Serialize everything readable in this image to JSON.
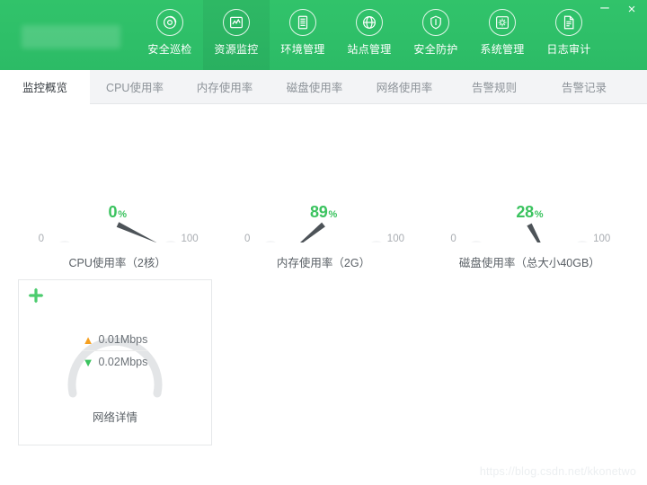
{
  "window": {
    "minimize_label": "–",
    "close_label": "×",
    "brand_redacted": true,
    "header_color": "#2fc069"
  },
  "nav": {
    "items": [
      {
        "label": "安全巡检",
        "icon": "radar-scan-icon",
        "active": false
      },
      {
        "label": "资源监控",
        "icon": "chart-monitor-icon",
        "active": true
      },
      {
        "label": "环境管理",
        "icon": "server-stack-icon",
        "active": false
      },
      {
        "label": "站点管理",
        "icon": "globe-icon",
        "active": false
      },
      {
        "label": "安全防护",
        "icon": "shield-icon",
        "active": false
      },
      {
        "label": "系统管理",
        "icon": "gear-box-icon",
        "active": false
      },
      {
        "label": "日志审计",
        "icon": "document-icon",
        "active": false
      }
    ]
  },
  "tabs": [
    {
      "label": "监控概览",
      "active": true
    },
    {
      "label": "CPU使用率",
      "active": false
    },
    {
      "label": "内存使用率",
      "active": false
    },
    {
      "label": "磁盘使用率",
      "active": false
    },
    {
      "label": "网络使用率",
      "active": false
    },
    {
      "label": "告警规则",
      "active": false
    },
    {
      "label": "告警记录",
      "active": false
    }
  ],
  "chart_data": [
    {
      "type": "gauge",
      "title": "CPU使用率（2核）",
      "value": 0,
      "value_text": "0",
      "unit": "%",
      "min": 0,
      "max": 100,
      "min_label": "0",
      "max_label": "100",
      "value_color": "#3bc35f",
      "bands": [
        {
          "from": 0,
          "to": 8,
          "color": "#2196f3"
        },
        {
          "from": 8,
          "to": 72,
          "color": "#62c133"
        },
        {
          "from": 72,
          "to": 86,
          "color": "#f59c1a"
        },
        {
          "from": 86,
          "to": 100,
          "color": "#e63c2f"
        }
      ]
    },
    {
      "type": "gauge",
      "title": "内存使用率（2G）",
      "value": 89,
      "value_text": "89",
      "unit": "%",
      "min": 0,
      "max": 100,
      "min_label": "0",
      "max_label": "100",
      "value_color": "#3bc35f",
      "bands": [
        {
          "from": 0,
          "to": 8,
          "color": "#2196f3"
        },
        {
          "from": 8,
          "to": 72,
          "color": "#62c133"
        },
        {
          "from": 72,
          "to": 86,
          "color": "#f59c1a"
        },
        {
          "from": 86,
          "to": 100,
          "color": "#e63c2f"
        }
      ]
    },
    {
      "type": "gauge",
      "title": "磁盘使用率（总大小40GB）",
      "value": 28,
      "value_text": "28",
      "unit": "%",
      "min": 0,
      "max": 100,
      "min_label": "0",
      "max_label": "100",
      "value_color": "#3bc35f",
      "bands": [
        {
          "from": 0,
          "to": 8,
          "color": "#2196f3"
        },
        {
          "from": 8,
          "to": 72,
          "color": "#62c133"
        },
        {
          "from": 72,
          "to": 86,
          "color": "#f59c1a"
        },
        {
          "from": 86,
          "to": 100,
          "color": "#e63c2f"
        }
      ]
    }
  ],
  "network_card": {
    "add_icon": "plus-icon",
    "upload": {
      "icon": "arrow-up-icon",
      "value": "0.01Mbps",
      "color": "#f6a020"
    },
    "download": {
      "icon": "arrow-down-icon",
      "value": "0.02Mbps",
      "color": "#3bc35f"
    },
    "caption": "网络详情",
    "ring_color": "#e3e5e7"
  },
  "watermark": "https://blog.csdn.net/kkonetwo"
}
